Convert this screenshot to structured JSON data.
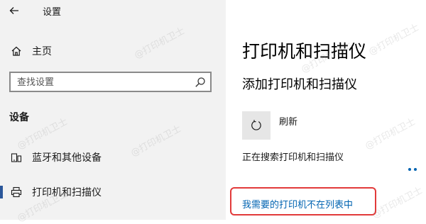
{
  "header": {
    "back_icon": "arrow-left-icon",
    "title": "设置"
  },
  "sidebar": {
    "home": {
      "label": "主页",
      "icon": "home-icon"
    },
    "search": {
      "placeholder": "查找设置",
      "icon": "search-icon"
    },
    "section_heading": "设备",
    "items": [
      {
        "label": "蓝牙和其他设备",
        "icon": "devices-icon",
        "selected": false
      },
      {
        "label": "打印机和扫描仪",
        "icon": "printer-icon",
        "selected": true
      }
    ]
  },
  "main": {
    "title": "打印机和扫描仪",
    "subtitle": "添加打印机和扫描仪",
    "refresh": {
      "label": "刷新",
      "icon": "refresh-icon"
    },
    "status_text": "正在搜索打印机和扫描仪",
    "missing_printer_link": "我需要的打印机不在列表中"
  },
  "watermark_text": "@打印机卫士",
  "colors": {
    "sidebar_bg": "#f2f2f2",
    "accent": "#0063b1",
    "highlight_border": "#e23a3a",
    "selected_indicator": "#2b579a"
  }
}
